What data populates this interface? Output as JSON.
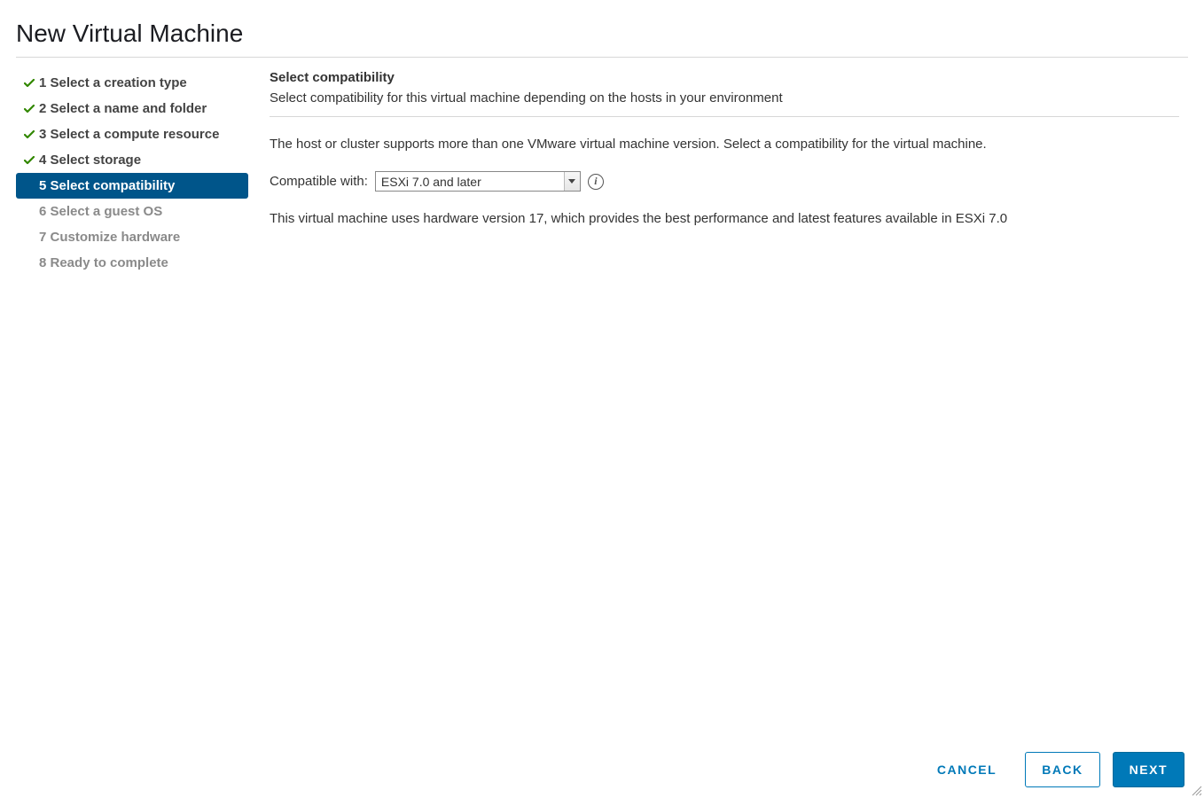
{
  "title": "New Virtual Machine",
  "steps": [
    {
      "label": "1 Select a creation type",
      "state": "done"
    },
    {
      "label": "2 Select a name and folder",
      "state": "done"
    },
    {
      "label": "3 Select a compute resource",
      "state": "done"
    },
    {
      "label": "4 Select storage",
      "state": "done"
    },
    {
      "label": "5 Select compatibility",
      "state": "current"
    },
    {
      "label": "6 Select a guest OS",
      "state": "future"
    },
    {
      "label": "7 Customize hardware",
      "state": "future"
    },
    {
      "label": "8 Ready to complete",
      "state": "future"
    }
  ],
  "content": {
    "heading": "Select compatibility",
    "subheading": "Select compatibility for this virtual machine depending on the hosts in your environment",
    "description": "The host or cluster supports more than one VMware virtual machine version. Select a compatibility for the virtual machine.",
    "field_label": "Compatible with:",
    "select_value": "ESXi 7.0 and later",
    "hint": "This virtual machine uses hardware version 17, which provides the best performance and latest features available in ESXi 7.0"
  },
  "footer": {
    "cancel": "CANCEL",
    "back": "BACK",
    "next": "NEXT"
  },
  "info_glyph": "i"
}
